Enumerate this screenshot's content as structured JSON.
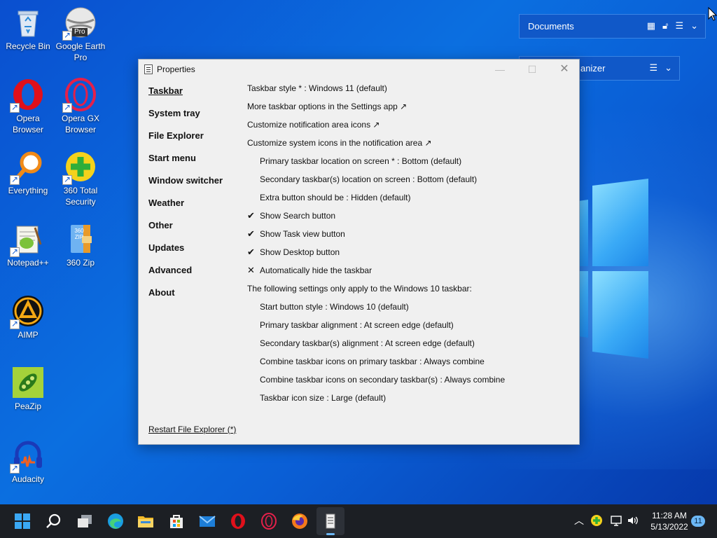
{
  "desktop": {
    "icons": [
      {
        "label": "Recycle Bin"
      },
      {
        "label": "Google Earth Pro"
      },
      {
        "label": "Opera Browser"
      },
      {
        "label": "Opera GX Browser"
      },
      {
        "label": "Everything"
      },
      {
        "label": "360 Total Security"
      },
      {
        "label": "Notepad++"
      },
      {
        "label": "360 Zip"
      },
      {
        "label": "AIMP"
      },
      {
        "label": "PeaZip"
      },
      {
        "label": "Audacity"
      }
    ],
    "earth_badge": "Pro",
    "zip_badge": "360 ZIP"
  },
  "toolbars": {
    "documents": "Documents",
    "organizer": "anizer"
  },
  "window": {
    "title": "Properties",
    "nav": [
      "Taskbar",
      "System tray",
      "File Explorer",
      "Start menu",
      "Window switcher",
      "Weather",
      "Other",
      "Updates",
      "Advanced",
      "About"
    ],
    "active_nav": "Taskbar",
    "settings": [
      {
        "text": "Taskbar style * : Windows 11 (default)"
      },
      {
        "text": "More taskbar options in the Settings app ↗"
      },
      {
        "text": "Customize notification area icons ↗"
      },
      {
        "text": "Customize system icons in the notification area ↗"
      },
      {
        "text": "Primary taskbar location on screen * : Bottom (default)"
      },
      {
        "text": "Secondary taskbar(s) location on screen : Bottom (default)"
      },
      {
        "text": "Extra button should be : Hidden (default)"
      },
      {
        "text": "Show Search button",
        "mark": "✔"
      },
      {
        "text": "Show Task view button",
        "mark": "✔"
      },
      {
        "text": "Show Desktop button",
        "mark": "✔"
      },
      {
        "text": "Automatically hide the taskbar",
        "mark": "✕"
      },
      {
        "text": "The following settings only apply to the Windows 10 taskbar:"
      },
      {
        "text": "Start button style : Windows 10 (default)"
      },
      {
        "text": "Primary taskbar alignment : At screen edge (default)"
      },
      {
        "text": "Secondary taskbar(s) alignment : At screen edge (default)"
      },
      {
        "text": "Combine taskbar icons on primary taskbar : Always combine"
      },
      {
        "text": "Combine taskbar icons on secondary taskbar(s) : Always combine"
      },
      {
        "text": "Taskbar icon size : Large (default)"
      }
    ],
    "restart_link": "Restart File Explorer (*)"
  },
  "taskbar": {
    "apps": [
      "start-icon",
      "search-icon",
      "task-view-icon",
      "edge-icon",
      "file-explorer-icon",
      "store-icon",
      "mail-icon",
      "opera-icon",
      "opera-gx-icon",
      "firefox-icon",
      "properties-app-icon"
    ],
    "time": "11:28 AM",
    "date": "5/13/2022",
    "notification_count": "11"
  },
  "colors": {
    "accent": "#0b6fe0",
    "taskbar": "#1c1f24",
    "window_bg": "#f0f0f0"
  }
}
